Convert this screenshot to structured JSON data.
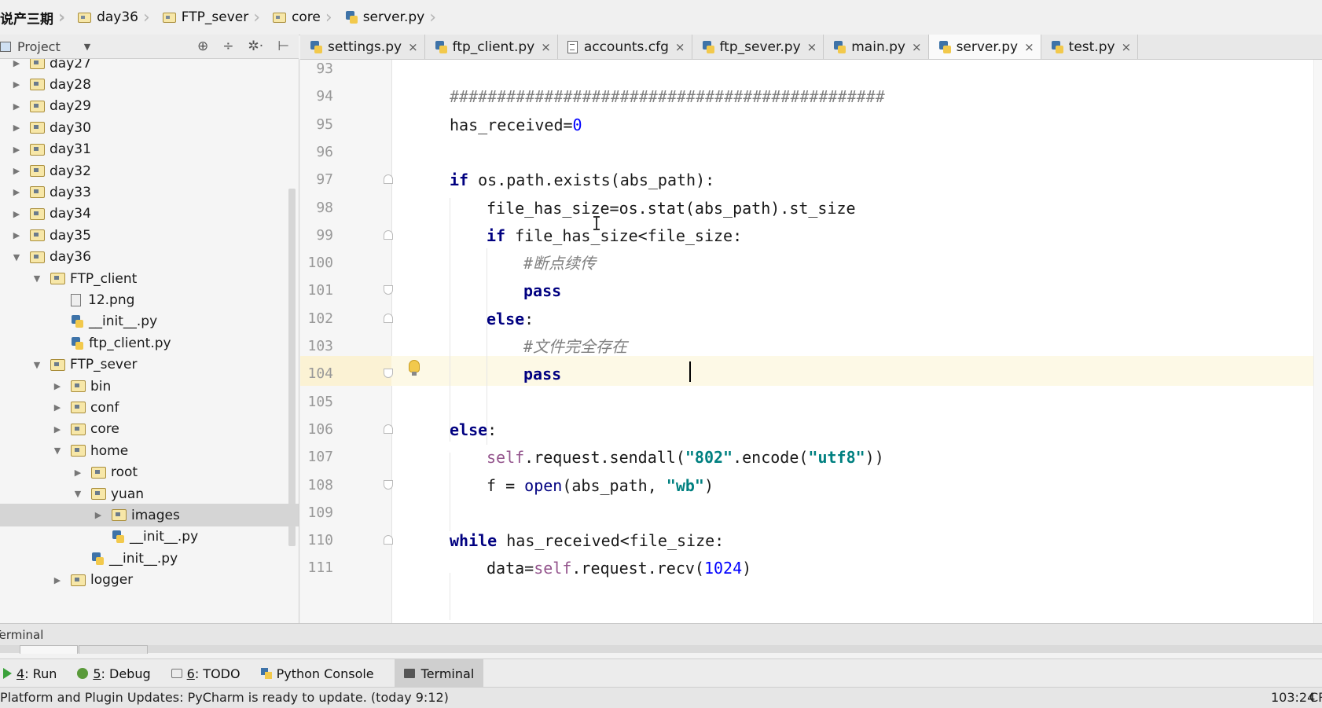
{
  "breadcrumb": [
    {
      "label": "说产三期",
      "icon": "none"
    },
    {
      "label": "day36",
      "icon": "folder-icon"
    },
    {
      "label": "FTP_sever",
      "icon": "folder-icon"
    },
    {
      "label": "core",
      "icon": "folder-icon"
    },
    {
      "label": "server.py",
      "icon": "python-file-icon"
    }
  ],
  "project_panel": {
    "title": "Project",
    "dropdown": "▼",
    "tools": [
      "⊕",
      "÷",
      "✲·",
      "⊢"
    ]
  },
  "tabs": [
    {
      "label": "settings.py",
      "icon": "python-file-icon",
      "active": false
    },
    {
      "label": "ftp_client.py",
      "icon": "python-file-icon",
      "active": false
    },
    {
      "label": "accounts.cfg",
      "icon": "cfg-file-icon",
      "active": false
    },
    {
      "label": "ftp_sever.py",
      "icon": "python-file-icon",
      "active": false
    },
    {
      "label": "main.py",
      "icon": "python-file-icon",
      "active": false
    },
    {
      "label": "server.py",
      "icon": "python-file-icon",
      "active": true
    },
    {
      "label": "test.py",
      "icon": "python-file-icon",
      "active": false
    }
  ],
  "tab_close": "×",
  "tree": [
    {
      "label": "day27",
      "type": "folder",
      "depth": 0,
      "expanded": false
    },
    {
      "label": "day28",
      "type": "folder",
      "depth": 0,
      "expanded": false
    },
    {
      "label": "day29",
      "type": "folder",
      "depth": 0,
      "expanded": false
    },
    {
      "label": "day30",
      "type": "folder",
      "depth": 0,
      "expanded": false
    },
    {
      "label": "day31",
      "type": "folder",
      "depth": 0,
      "expanded": false
    },
    {
      "label": "day32",
      "type": "folder",
      "depth": 0,
      "expanded": false
    },
    {
      "label": "day33",
      "type": "folder",
      "depth": 0,
      "expanded": false
    },
    {
      "label": "day34",
      "type": "folder",
      "depth": 0,
      "expanded": false
    },
    {
      "label": "day35",
      "type": "folder",
      "depth": 0,
      "expanded": false
    },
    {
      "label": "day36",
      "type": "folder",
      "depth": 0,
      "expanded": true
    },
    {
      "label": "FTP_client",
      "type": "folder",
      "depth": 1,
      "expanded": true
    },
    {
      "label": "12.png",
      "type": "file",
      "depth": 2
    },
    {
      "label": "__init__.py",
      "type": "python",
      "depth": 2
    },
    {
      "label": "ftp_client.py",
      "type": "python",
      "depth": 2
    },
    {
      "label": "FTP_sever",
      "type": "folder",
      "depth": 1,
      "expanded": true
    },
    {
      "label": "bin",
      "type": "folder",
      "depth": 2,
      "expanded": false
    },
    {
      "label": "conf",
      "type": "folder",
      "depth": 2,
      "expanded": false
    },
    {
      "label": "core",
      "type": "folder",
      "depth": 2,
      "expanded": false
    },
    {
      "label": "home",
      "type": "folder",
      "depth": 2,
      "expanded": true
    },
    {
      "label": "root",
      "type": "folder",
      "depth": 3,
      "expanded": false
    },
    {
      "label": "yuan",
      "type": "folder",
      "depth": 3,
      "expanded": true
    },
    {
      "label": "images",
      "type": "folder",
      "depth": 4,
      "expanded": false,
      "selected": true
    },
    {
      "label": "__init__.py",
      "type": "python",
      "depth": 4
    },
    {
      "label": "__init__.py",
      "type": "python",
      "depth": 3
    },
    {
      "label": "logger",
      "type": "folder",
      "depth": 2,
      "expanded": false
    }
  ],
  "code_lines": [
    {
      "num": "93",
      "indent": 0,
      "tokens": []
    },
    {
      "num": "94",
      "indent": 1,
      "tokens": [
        {
          "t": "##############################################",
          "c": "cmt"
        }
      ]
    },
    {
      "num": "95",
      "indent": 1,
      "tokens": [
        {
          "t": "has_received=",
          "c": ""
        },
        {
          "t": "0",
          "c": "num"
        }
      ]
    },
    {
      "num": "96",
      "indent": 0,
      "tokens": []
    },
    {
      "num": "97",
      "indent": 1,
      "tokens": [
        {
          "t": "if",
          "c": "kw"
        },
        {
          "t": " os.path.exists(abs_path):",
          "c": ""
        }
      ]
    },
    {
      "num": "98",
      "indent": 2,
      "tokens": [
        {
          "t": "file_has_size=os.stat(abs_path).st_size",
          "c": ""
        }
      ]
    },
    {
      "num": "99",
      "indent": 2,
      "tokens": [
        {
          "t": "if",
          "c": "kw"
        },
        {
          "t": " file_has_size<file_size:",
          "c": ""
        }
      ]
    },
    {
      "num": "100",
      "indent": 3,
      "tokens": [
        {
          "t": "#断点续传",
          "c": "cmt"
        }
      ]
    },
    {
      "num": "101",
      "indent": 3,
      "tokens": [
        {
          "t": "pass",
          "c": "kw"
        }
      ]
    },
    {
      "num": "102",
      "indent": 2,
      "tokens": [
        {
          "t": "else",
          "c": "kw"
        },
        {
          "t": ":",
          "c": ""
        }
      ]
    },
    {
      "num": "103",
      "indent": 3,
      "tokens": [
        {
          "t": "#文件完全存在",
          "c": "cmt"
        }
      ]
    },
    {
      "num": "104",
      "indent": 3,
      "tokens": [
        {
          "t": "pass",
          "c": "kw"
        }
      ]
    },
    {
      "num": "105",
      "indent": 0,
      "tokens": []
    },
    {
      "num": "106",
      "indent": 1,
      "tokens": [
        {
          "t": "else",
          "c": "kw"
        },
        {
          "t": ":",
          "c": ""
        }
      ]
    },
    {
      "num": "107",
      "indent": 2,
      "tokens": [
        {
          "t": "self",
          "c": "self"
        },
        {
          "t": ".request.sendall(",
          "c": ""
        },
        {
          "t": "\"802\"",
          "c": "str"
        },
        {
          "t": ".encode(",
          "c": ""
        },
        {
          "t": "\"utf8\"",
          "c": "str"
        },
        {
          "t": "))",
          "c": ""
        }
      ]
    },
    {
      "num": "108",
      "indent": 2,
      "tokens": [
        {
          "t": "f = ",
          "c": ""
        },
        {
          "t": "open",
          "c": "builtin"
        },
        {
          "t": "(abs_path, ",
          "c": ""
        },
        {
          "t": "\"wb\"",
          "c": "str"
        },
        {
          "t": ")",
          "c": ""
        }
      ]
    },
    {
      "num": "109",
      "indent": 0,
      "tokens": []
    },
    {
      "num": "110",
      "indent": 1,
      "tokens": [
        {
          "t": "while",
          "c": "kw"
        },
        {
          "t": " has_received<file_size:",
          "c": ""
        }
      ]
    },
    {
      "num": "111",
      "indent": 2,
      "tokens": [
        {
          "t": "data=",
          "c": ""
        },
        {
          "t": "self",
          "c": "self"
        },
        {
          "t": ".request.recv(",
          "c": ""
        },
        {
          "t": "1024",
          "c": "num"
        },
        {
          "t": ")",
          "c": ""
        }
      ]
    }
  ],
  "terminal": {
    "title": "Terminal"
  },
  "tool_windows": [
    {
      "key": "4",
      "label": ": Run",
      "icon": "run-icon"
    },
    {
      "key": "5",
      "label": ": Debug",
      "icon": "debug-icon"
    },
    {
      "key": "6",
      "label": ": TODO",
      "icon": "todo-icon"
    },
    {
      "key": "",
      "label": "Python Console",
      "icon": "python-console-icon"
    },
    {
      "key": "",
      "label": "Terminal",
      "icon": "terminal-icon",
      "active": true
    }
  ],
  "status": {
    "message": "Platform and Plugin Updates: PyCharm is ready to update. (today 9:12)",
    "position": "103:24",
    "line_sep": "CRL"
  }
}
